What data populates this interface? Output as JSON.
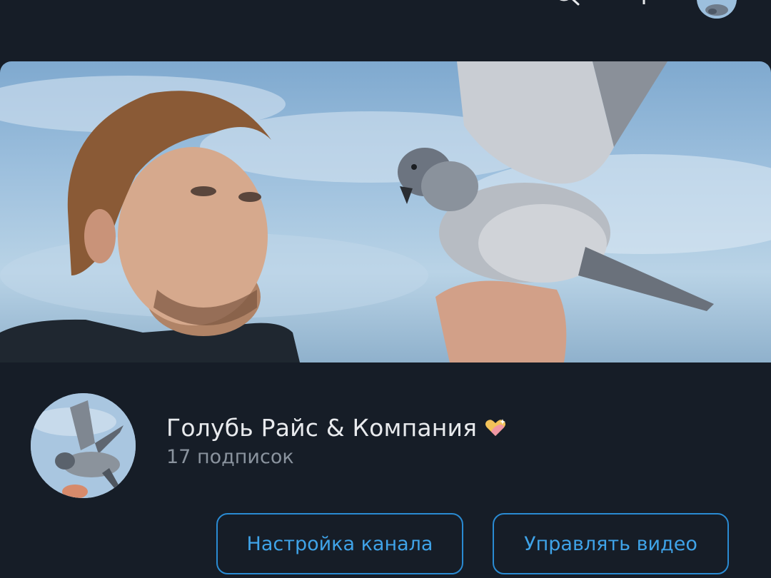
{
  "header": {
    "icons": [
      "search-icon",
      "mic-icon",
      "account-avatar"
    ]
  },
  "channel": {
    "name": "Голубь Райс & Компания",
    "badge_icon": "sparkling-heart-icon",
    "subscribers": "17 подписок"
  },
  "actions": {
    "settings_label": "Настройка канала",
    "manage_label": "Управлять видео"
  },
  "colors": {
    "background": "#161d27",
    "accent": "#3fa3e8",
    "button_border": "#2a8bd3",
    "title_text": "#e8eaed",
    "secondary_text": "#8a939e"
  }
}
